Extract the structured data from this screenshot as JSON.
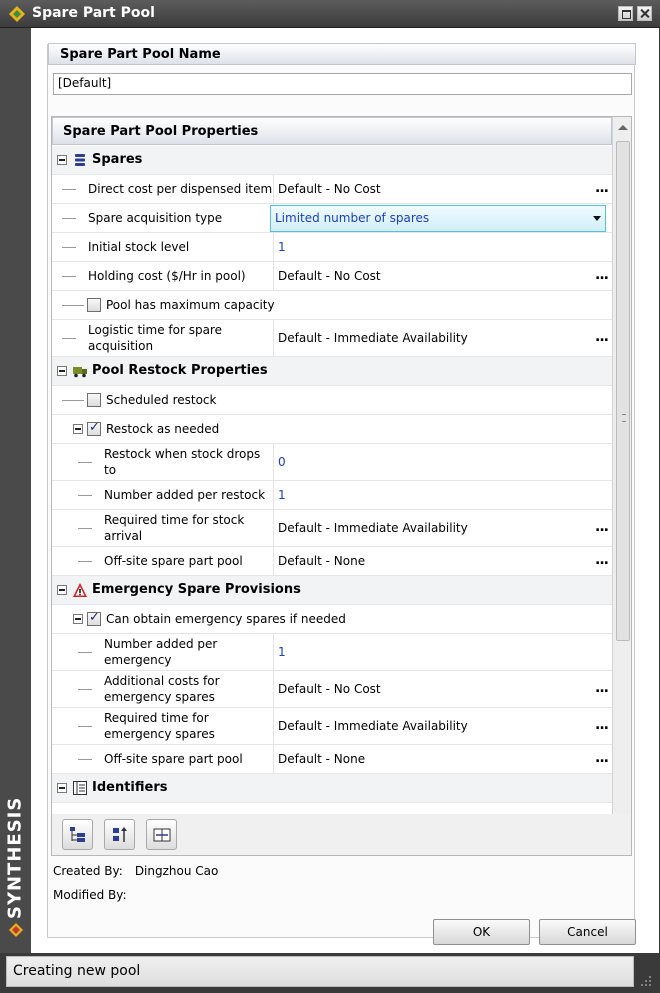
{
  "window": {
    "title": "Spare Part Pool",
    "brand": "SYNTHESIS"
  },
  "name_section": {
    "header": "Spare Part Pool Name",
    "value": "[Default]"
  },
  "properties": {
    "header": "Spare Part Pool Properties",
    "spares": {
      "title": "Spares",
      "direct_cost_label": "Direct cost per dispensed item",
      "direct_cost_value": "Default - No Cost",
      "acquisition_label": "Spare acquisition type",
      "acquisition_value": "Limited number of spares",
      "initial_stock_label": "Initial stock level",
      "initial_stock_value": "1",
      "holding_cost_label": "Holding cost ($/Hr in pool)",
      "holding_cost_value": "Default - No Cost",
      "max_capacity_label": "Pool has maximum capacity",
      "logistic_label_1": "Logistic time for spare",
      "logistic_label_2": "acquisition",
      "logistic_value": "Default - Immediate Availability"
    },
    "restock": {
      "title": "Pool Restock Properties",
      "scheduled_label": "Scheduled restock",
      "as_needed_label": "Restock as needed",
      "when_drops_label_1": "Restock when stock drops",
      "when_drops_label_2": "to",
      "when_drops_value": "0",
      "number_added_label": "Number added per restock",
      "number_added_value": "1",
      "arrival_label_1": "Required time for stock",
      "arrival_label_2": "arrival",
      "arrival_value": "Default - Immediate Availability",
      "offsite_label": "Off-site spare part pool",
      "offsite_value": "Default - None"
    },
    "emergency": {
      "title": "Emergency Spare Provisions",
      "can_obtain_label": "Can obtain emergency spares if needed",
      "number_added_label_1": "Number added per",
      "number_added_label_2": "emergency",
      "number_added_value": "1",
      "additional_costs_label_1": "Additional costs for",
      "additional_costs_label_2": "emergency spares",
      "additional_costs_value": "Default - No Cost",
      "required_time_label_1": "Required time for",
      "required_time_label_2": "emergency spares",
      "required_time_value": "Default - Immediate Availability",
      "offsite_label": "Off-site spare part pool",
      "offsite_value": "Default - None"
    },
    "identifiers": {
      "title": "Identifiers"
    },
    "ellipsis": "..."
  },
  "meta": {
    "created_by_label": "Created By:",
    "created_by_value": "Dingzhou Cao",
    "modified_by_label": "Modified By:"
  },
  "buttons": {
    "ok": "OK",
    "cancel": "Cancel"
  },
  "status": {
    "text": "Creating new pool"
  },
  "colors": {
    "value_blue": "#1a3fbf",
    "dropdown_border": "#55bfdc",
    "warning_red": "#d42020"
  }
}
